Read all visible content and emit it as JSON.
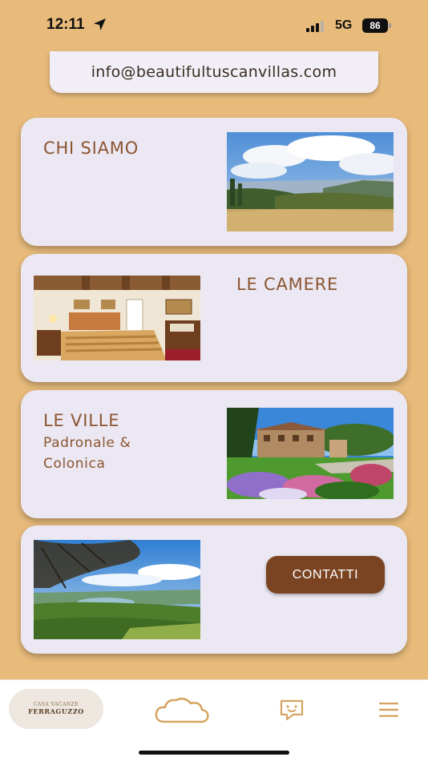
{
  "status_bar": {
    "time": "12:11",
    "network": "5G",
    "battery": "86"
  },
  "email": "info@beautifultuscanvillas.com",
  "cards": [
    {
      "title": "CHI SIAMO",
      "image": "tuscan-landscape-photo"
    },
    {
      "title": "LE CAMERE",
      "image": "bedroom-photo"
    },
    {
      "title": "LE VILLE",
      "subtitle_line1": "Padronale &",
      "subtitle_line2": "Colonica",
      "image": "villa-garden-photo"
    },
    {
      "button_label": "CONTATTI",
      "image": "lake-valley-photo"
    }
  ],
  "tabbar": {
    "logo_line1": "CASA VACANZE",
    "logo_line2": "FERRAGUZZO",
    "icons": [
      "cloud-icon",
      "chat-icon",
      "menu-icon"
    ]
  },
  "colors": {
    "background": "#e8bb7b",
    "card": "#ece8f3",
    "accent": "#8a5530",
    "button": "#7a4423"
  }
}
